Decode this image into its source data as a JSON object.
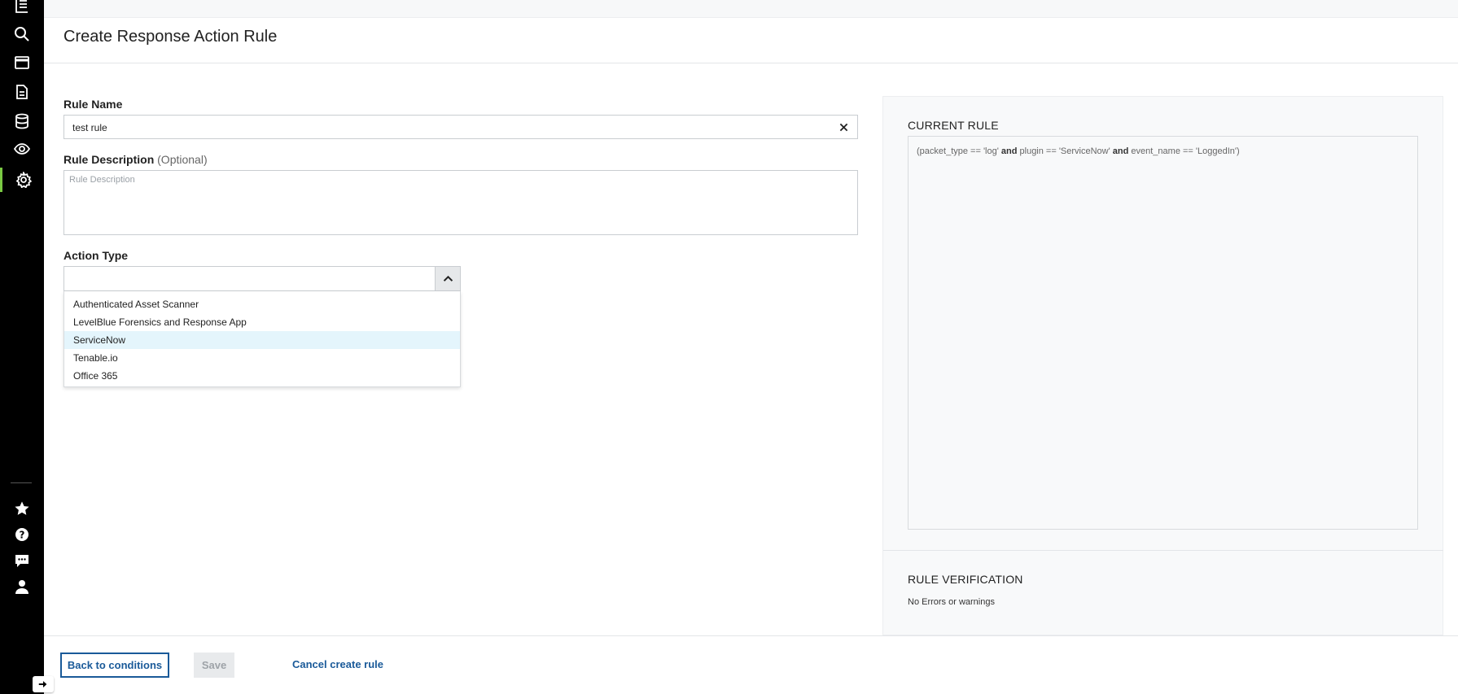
{
  "page": {
    "title": "Create Response Action Rule"
  },
  "form": {
    "rule_name_label": "Rule Name",
    "rule_name_value": "test rule",
    "rule_description_label": "Rule Description",
    "rule_description_optional": "(Optional)",
    "rule_description_placeholder": "Rule Description",
    "action_type_label": "Action Type",
    "action_type_value": "",
    "action_type_options": [
      "Authenticated Asset Scanner",
      "LevelBlue Forensics and Response App",
      "ServiceNow",
      "Tenable.io",
      "Office 365"
    ],
    "highlighted_option": "ServiceNow"
  },
  "current_rule": {
    "title": "CURRENT RULE",
    "parts": {
      "p1": "(packet_type == 'log' ",
      "and1": "and",
      "p2": " plugin == 'ServiceNow' ",
      "and2": "and",
      "p3": " event_name == 'LoggedIn')"
    }
  },
  "verification": {
    "title": "RULE VERIFICATION",
    "status": "No Errors or warnings"
  },
  "footer": {
    "back_label": "Back to conditions",
    "save_label": "Save",
    "cancel_label": "Cancel create rule"
  },
  "nav": {
    "icons": [
      "report-icon",
      "search-icon",
      "dashboard-icon",
      "document-icon",
      "database-icon",
      "eye-icon",
      "gear-icon",
      "star-icon",
      "help-icon",
      "chat-icon",
      "user-icon",
      "expand-arrow-icon"
    ],
    "active_color": "#7ac943"
  },
  "colors": {
    "link": "#1a5a99",
    "highlight": "#e4f5fc"
  }
}
